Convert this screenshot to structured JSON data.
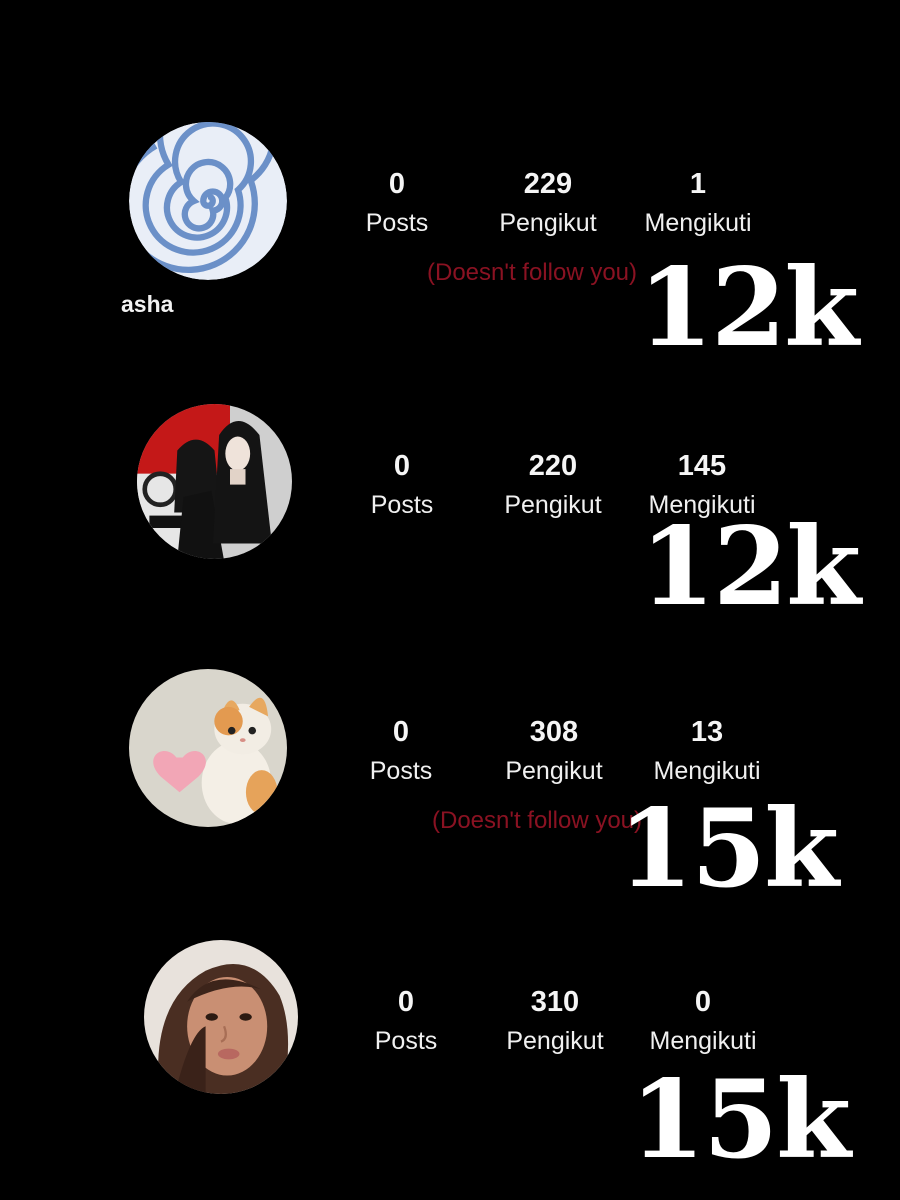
{
  "profiles": [
    {
      "username": "asha",
      "avatar_icon": "blue-spiral-icon",
      "posts": "0",
      "posts_label": "Posts",
      "followers": "229",
      "followers_label": "Pengikut",
      "following": "1",
      "following_label": "Mengikuti",
      "note": "(Doesn't follow you)",
      "overlay": "12k"
    },
    {
      "avatar_icon": "two-girls-red-collage-icon",
      "posts": "0",
      "posts_label": "Posts",
      "followers": "220",
      "followers_label": "Pengikut",
      "following": "145",
      "following_label": "Mengikuti",
      "overlay": "12k"
    },
    {
      "avatar_icon": "kitten-with-heart-icon",
      "posts": "0",
      "posts_label": "Posts",
      "followers": "308",
      "followers_label": "Pengikut",
      "following": "13",
      "following_label": "Mengikuti",
      "note": "(Doesn't follow you)",
      "overlay": "15k"
    },
    {
      "avatar_icon": "girl-portrait-icon",
      "posts": "0",
      "posts_label": "Posts",
      "followers": "310",
      "followers_label": "Pengikut",
      "following": "0",
      "following_label": "Mengikuti",
      "overlay": "15k"
    }
  ],
  "colors": {
    "background": "#000000",
    "note": "#8a1222",
    "text": "#ffffff"
  }
}
